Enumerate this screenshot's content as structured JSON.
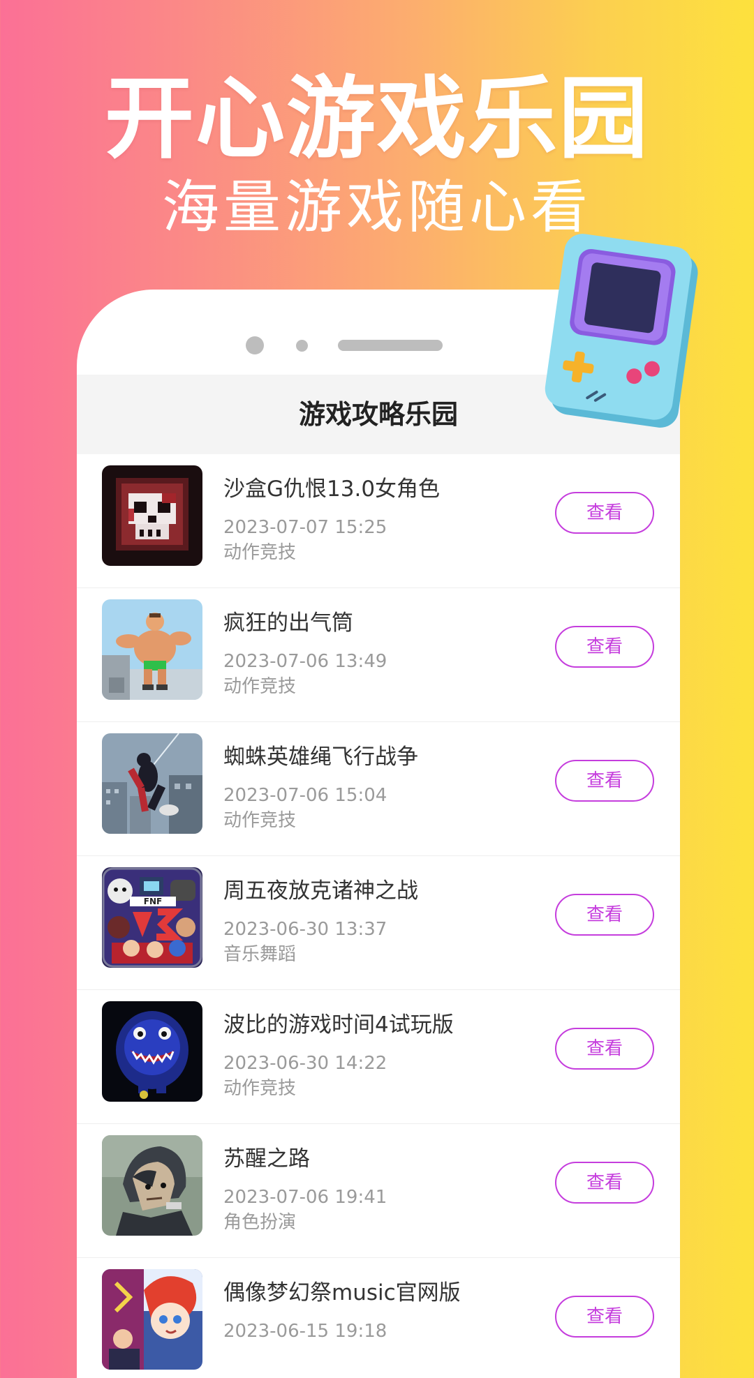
{
  "hero": {
    "title": "开心游戏乐园",
    "subtitle": "海量游戏随心看"
  },
  "app": {
    "title": "游戏攻略乐园"
  },
  "colors": {
    "accent": "#c53ddd",
    "bg_left": "#fb7096",
    "bg_right": "#fde13d"
  },
  "games": [
    {
      "name": "沙盒G仇恨13.0女角色",
      "date": "2023-07-07 15:25",
      "category": "动作竞技",
      "button": "查看",
      "icon": "skull-game-icon"
    },
    {
      "name": "疯狂的出气筒",
      "date": "2023-07-06 13:49",
      "category": "动作竞技",
      "button": "查看",
      "icon": "wrestler-game-icon"
    },
    {
      "name": "蜘蛛英雄绳飞行战争",
      "date": "2023-07-06 15:04",
      "category": "动作竞技",
      "button": "查看",
      "icon": "spider-hero-game-icon"
    },
    {
      "name": "周五夜放克诸神之战",
      "date": "2023-06-30 13:37",
      "category": "音乐舞蹈",
      "button": "查看",
      "icon": "fnf-vs-game-icon"
    },
    {
      "name": "波比的游戏时间4试玩版",
      "date": "2023-06-30 14:22",
      "category": "动作竞技",
      "button": "查看",
      "icon": "blue-monster-game-icon"
    },
    {
      "name": "苏醒之路",
      "date": "2023-07-06 19:41",
      "category": "角色扮演",
      "button": "查看",
      "icon": "helmet-character-game-icon"
    },
    {
      "name": "偶像梦幻祭music官网版",
      "date": "2023-06-15 19:18",
      "category": "",
      "button": "查看",
      "icon": "anime-idol-game-icon"
    }
  ]
}
